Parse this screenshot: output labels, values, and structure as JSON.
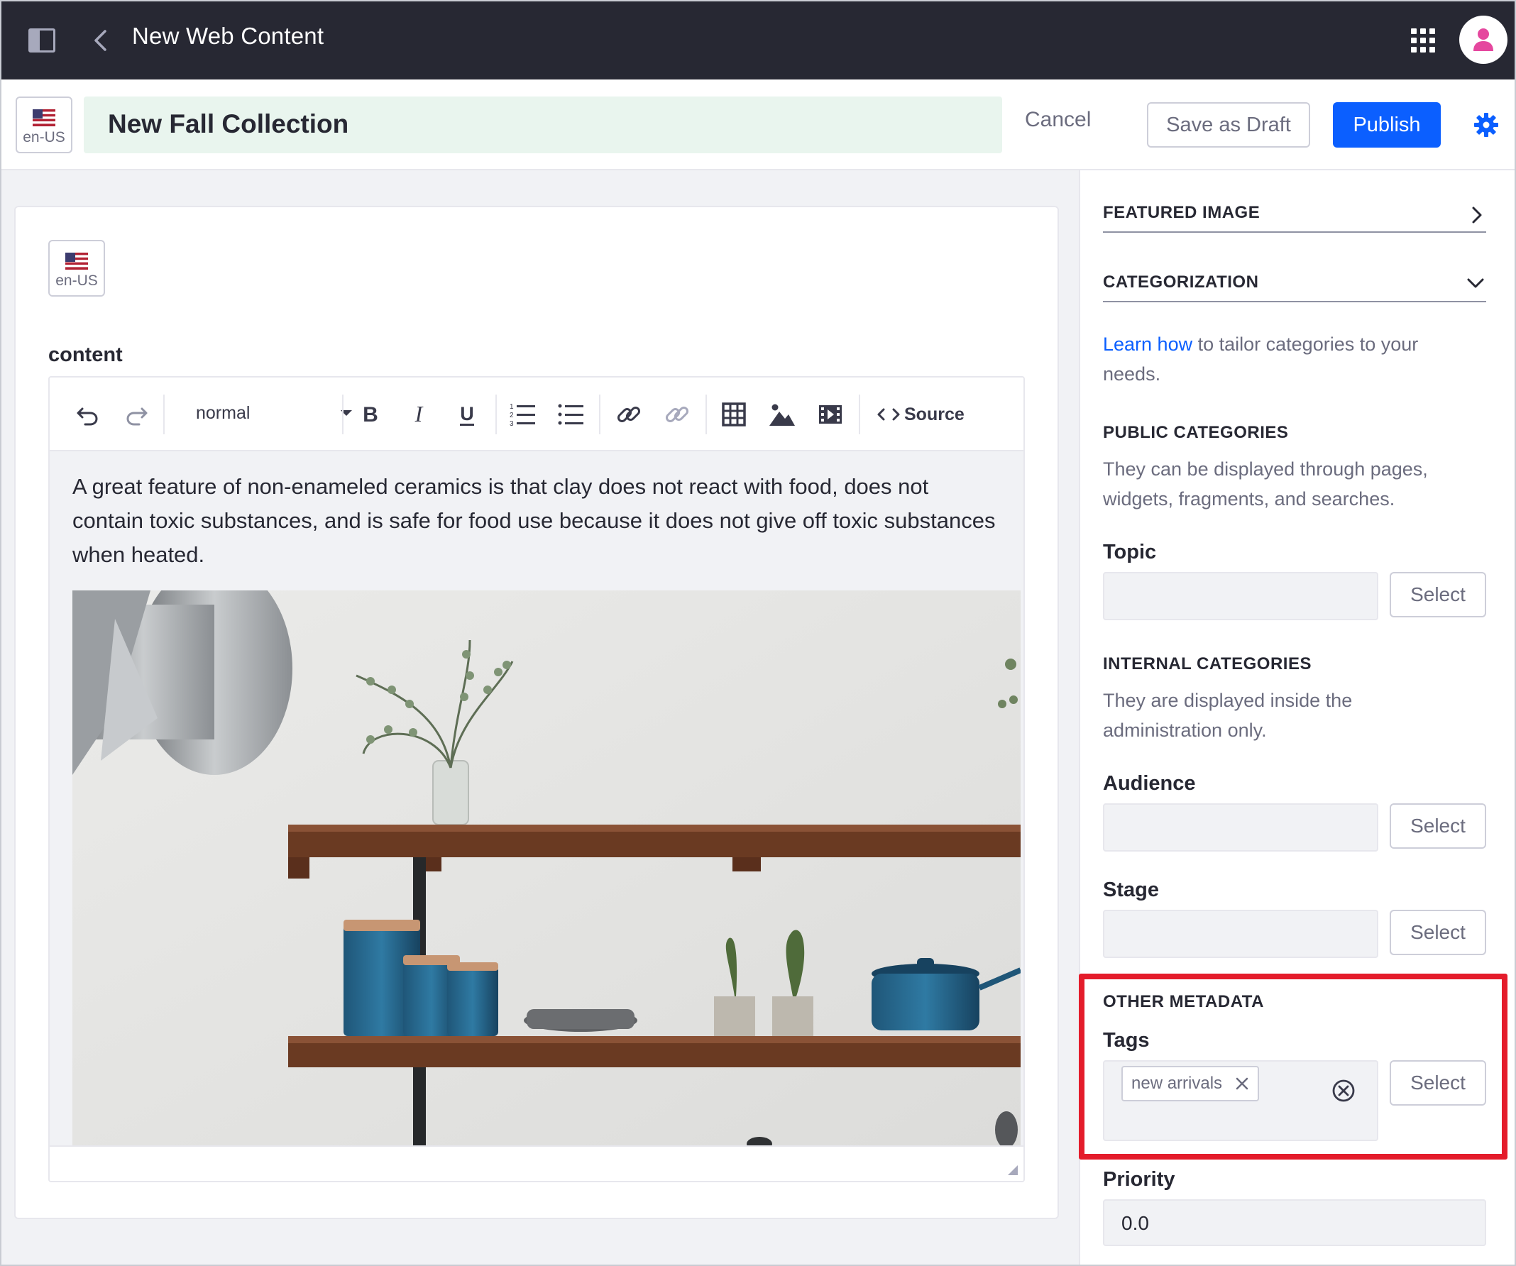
{
  "topbar": {
    "title": "New Web Content",
    "sidebar_toggle_icon": "sidebar-toggle-icon",
    "back_icon": "chevron-left-icon",
    "apps_icon": "apps-grid-icon",
    "user_icon": "user-avatar-icon"
  },
  "header": {
    "locale": "en-US",
    "title_value": "New Fall Collection",
    "cancel_label": "Cancel",
    "save_draft_label": "Save as Draft",
    "publish_label": "Publish",
    "settings_icon": "gear-icon",
    "colors": {
      "accent": "#0b5fff",
      "title_bg": "#e9f5ee",
      "topbar_bg": "#272833"
    }
  },
  "editor": {
    "locale": "en-US",
    "field_label": "content",
    "format_value": "normal",
    "source_label": "Source",
    "toolbar_icons": [
      "undo-icon",
      "redo-icon",
      "bold-icon",
      "italic-icon",
      "underline-icon",
      "ordered-list-icon",
      "unordered-list-icon",
      "link-icon",
      "unlink-icon",
      "table-icon",
      "image-icon",
      "video-icon",
      "source-code-icon"
    ],
    "body_text": "A great feature of non-enameled ceramics is that clay does not react with food, does not contain toxic substances, and is safe for food use because it does not give off toxic substances when heated.",
    "image_subject": "kitchen shelves with blue ceramic canisters, plates, cacti and a pot"
  },
  "sidebar": {
    "featured_image": {
      "label": "FEATURED IMAGE",
      "icon": "chevron-right-icon"
    },
    "categorization": {
      "label": "CATEGORIZATION",
      "icon": "chevron-down-icon",
      "intro_link": "Learn how",
      "intro_text": " to tailor categories to your needs.",
      "public": {
        "heading": "PUBLIC CATEGORIES",
        "description": "They can be displayed through pages, widgets, fragments, and searches.",
        "fields": [
          {
            "label": "Topic",
            "value": "",
            "button": "Select"
          }
        ]
      },
      "internal": {
        "heading": "INTERNAL CATEGORIES",
        "description": "They are displayed inside the administration only.",
        "fields": [
          {
            "label": "Audience",
            "value": "",
            "button": "Select"
          },
          {
            "label": "Stage",
            "value": "",
            "button": "Select"
          }
        ]
      }
    },
    "other_metadata": {
      "heading": "OTHER METADATA",
      "tags_label": "Tags",
      "tags": [
        "new arrivals"
      ],
      "tags_button": "Select",
      "clear_icon": "clear-circle-icon",
      "highlight_color": "#e41c2b"
    },
    "priority": {
      "label": "Priority",
      "value": "0.0"
    }
  }
}
